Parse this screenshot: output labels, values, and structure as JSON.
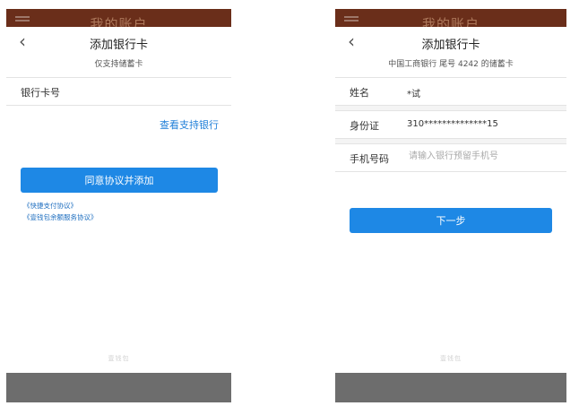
{
  "left": {
    "app_title": "我的账户",
    "header_title": "添加银行卡",
    "subnote": "仅支持储蓄卡",
    "card_field_label": "银行卡号",
    "supported_banks_link": "查看支持银行",
    "submit_label": "同意协议并添加",
    "agreements": [
      "《快捷支付协议》",
      "《壹钱包余额服务协议》"
    ],
    "footer_logo": "壹钱包"
  },
  "right": {
    "app_title": "我的账户",
    "header_title": "添加银行卡",
    "subnote": "中国工商银行 尾号 4242 的储蓄卡",
    "name_label": "姓名",
    "name_value": "*试",
    "id_label": "身份证",
    "id_value": "310**************15",
    "phone_label": "手机号码",
    "phone_placeholder": "请输入银行预留手机号",
    "next_label": "下一步",
    "footer_logo": "壹钱包"
  },
  "colors": {
    "primary": "#1e88e5",
    "appbar": "#6a2e1a",
    "bottom_bar": "#6d6d6d"
  },
  "icons": {
    "back": "chevron-left-icon",
    "menu": "menu-icon"
  }
}
